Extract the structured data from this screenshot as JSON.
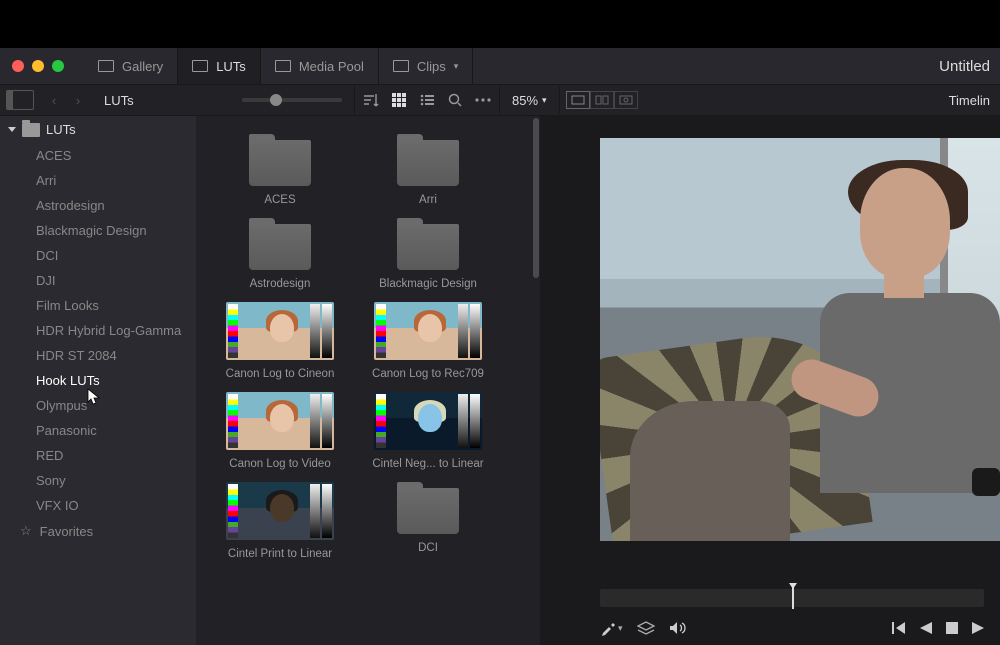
{
  "projectTitle": "Untitled",
  "tabs": [
    {
      "label": "Gallery",
      "active": false
    },
    {
      "label": "LUTs",
      "active": true
    },
    {
      "label": "Media Pool",
      "active": false
    },
    {
      "label": "Clips",
      "active": false,
      "caret": true
    }
  ],
  "breadcrumb": "LUTs",
  "zoomLevel": "85%",
  "timelineLabel": "Timelin",
  "sidebar": {
    "root": "LUTs",
    "items": [
      "ACES",
      "Arri",
      "Astrodesign",
      "Blackmagic Design",
      "DCI",
      "DJI",
      "Film Looks",
      "HDR Hybrid Log-Gamma",
      "HDR ST 2084",
      "Hook LUTs",
      "Olympus",
      "Panasonic",
      "RED",
      "Sony",
      "VFX IO"
    ],
    "selectedIndex": 9,
    "favorites": "Favorites"
  },
  "lutGrid": [
    {
      "type": "folder",
      "label": "ACES"
    },
    {
      "type": "folder",
      "label": "Arri"
    },
    {
      "type": "folder",
      "label": "Astrodesign"
    },
    {
      "type": "folder",
      "label": "Blackmagic Design"
    },
    {
      "type": "lut",
      "label": "Canon Log to Cineon",
      "selected": true,
      "variant": "norm"
    },
    {
      "type": "lut",
      "label": "Canon Log to Rec709",
      "variant": "norm"
    },
    {
      "type": "lut",
      "label": "Canon Log to Video",
      "variant": "norm"
    },
    {
      "type": "lut",
      "label": "Cintel Neg... to Linear",
      "variant": "neg"
    },
    {
      "type": "lut",
      "label": "Cintel Print to Linear",
      "variant": "dark"
    },
    {
      "type": "folder",
      "label": "DCI"
    }
  ]
}
